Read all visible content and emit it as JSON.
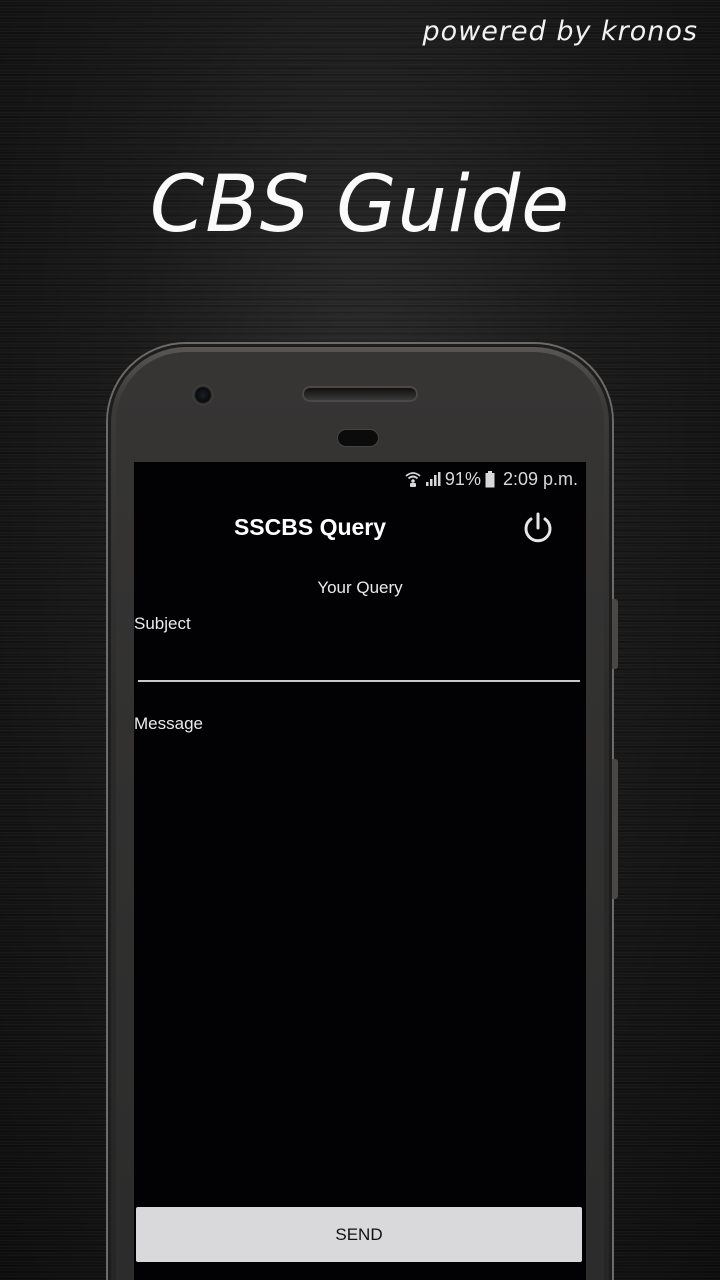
{
  "promo": {
    "powered_by": "powered by kronos",
    "title": "CBS Guide"
  },
  "status_bar": {
    "icons": [
      "wifi-calling-icon",
      "signal-icon",
      "battery-icon"
    ],
    "battery": "91%",
    "time": "2:09 p.m."
  },
  "app": {
    "title": "SSCBS Query",
    "power_icon": "power-icon",
    "section_title": "Your Query",
    "subject_label": "Subject",
    "subject_value": "",
    "message_label": "Message",
    "message_value": "",
    "send_label": "SEND"
  },
  "colors": {
    "screen_bg": "#020204",
    "send_button_bg": "#d9d9db",
    "underline": "#c9c9c9"
  }
}
